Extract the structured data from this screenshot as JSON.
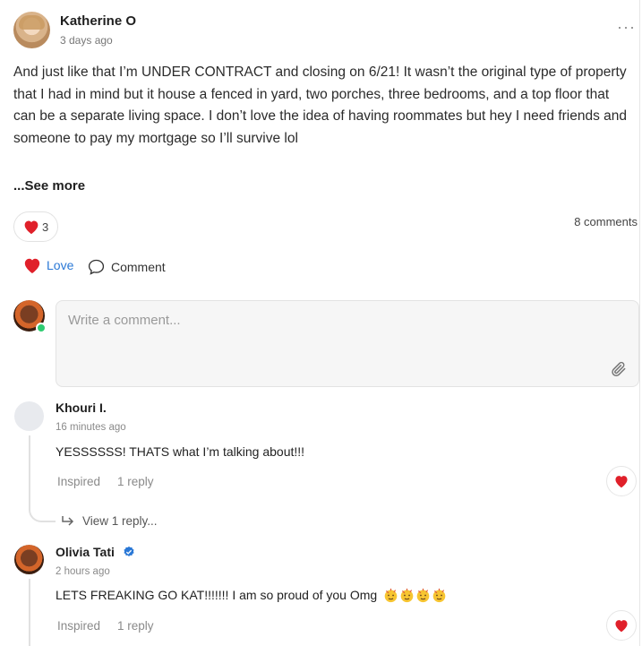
{
  "post": {
    "author": "Katherine O",
    "time": "3 days ago",
    "more_label": "···",
    "body": "And just like that I’m UNDER CONTRACT and closing on 6/21! It wasn’t the original type of property that I had in mind but it house a fenced in yard, two porches, three bedrooms, and a top floor that can be a separate living space. I don’t love the idea of having roommates but hey I need friends and someone to pay my mortgage so I’ll survive lol",
    "see_more": "...See more",
    "reaction_count": "3",
    "comments_count": "8 comments",
    "love_label": "Love",
    "comment_label": "Comment"
  },
  "composer": {
    "placeholder": "Write a comment..."
  },
  "comments": [
    {
      "name": "Khouri I.",
      "time": "16 minutes ago",
      "text": "YESSSSSS! THATS what I’m talking about!!!",
      "action1": "Inspired",
      "action2": "1 reply",
      "view_replies": "View 1 reply..."
    },
    {
      "name": "Olivia Tati",
      "time": "2 hours ago",
      "text": "LETS FREAKING GO KAT!!!!!!! I am so proud of you Omg",
      "action1": "Inspired",
      "action2": "1 reply"
    }
  ],
  "colors": {
    "accent_blue": "#2a78d6",
    "heart_red": "#e0202a",
    "online_green": "#2ecc71"
  },
  "icons": [
    "heart-icon",
    "speech-bubble-icon",
    "paperclip-icon",
    "verified-badge-icon",
    "reply-arrow-icon",
    "celebration-emoji-icon"
  ]
}
